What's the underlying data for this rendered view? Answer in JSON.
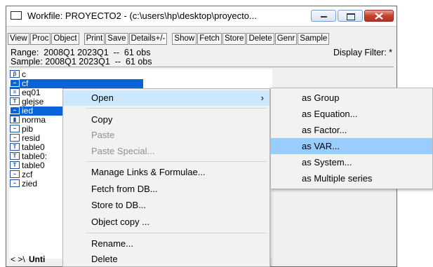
{
  "window": {
    "title": "Workfile: PROYECTO2 - (c:\\users\\hp\\desktop\\proyecto..."
  },
  "toolbar": [
    "View",
    "Proc",
    "Object",
    "Print",
    "Save",
    "Details+/-",
    "Show",
    "Fetch",
    "Store",
    "Delete",
    "Genr",
    "Sample"
  ],
  "info": {
    "range": "Range:  2008Q1 2023Q1  --  61 obs",
    "sample": "Sample: 2008Q1 2023Q1  --  61 obs",
    "filter": "Display Filter: *"
  },
  "objects": [
    {
      "name": "c",
      "icon": "beta-icon",
      "glyph": "β"
    },
    {
      "name": "cf",
      "icon": "series-icon",
      "glyph": "~"
    },
    {
      "name": "eq01",
      "icon": "equation-icon",
      "glyph": "="
    },
    {
      "name": "glejse",
      "icon": "table-icon",
      "glyph": "T"
    },
    {
      "name": "ied",
      "icon": "series-icon",
      "glyph": "~"
    },
    {
      "name": "norma",
      "icon": "graph-icon",
      "glyph": "▮"
    },
    {
      "name": "pib",
      "icon": "series-icon",
      "glyph": "~"
    },
    {
      "name": "resid",
      "icon": "series-icon",
      "glyph": "~"
    },
    {
      "name": "table0",
      "icon": "table-icon",
      "glyph": "T"
    },
    {
      "name": "table0:",
      "icon": "table-icon",
      "glyph": "T"
    },
    {
      "name": "table0",
      "icon": "table-icon",
      "glyph": "T"
    },
    {
      "name": "zcf",
      "icon": "series-icon",
      "glyph": "~"
    },
    {
      "name": "zied",
      "icon": "series-icon",
      "glyph": "~"
    }
  ],
  "tabs": {
    "nav": "< >\\",
    "current": "Unti"
  },
  "menu": {
    "open": "Open",
    "copy": "Copy",
    "paste": "Paste",
    "paste_special": "Paste Special...",
    "manage_links": "Manage Links & Formulae...",
    "fetch_db": "Fetch from DB...",
    "store_db": "Store to DB...",
    "object_copy": "Object copy ...",
    "rename": "Rename...",
    "delete": "Delete"
  },
  "submenu": [
    "as Group",
    "as Equation...",
    "as Factor...",
    "as VAR...",
    "as System...",
    "as Multiple series"
  ],
  "colors": {
    "selection": "#0a64d8",
    "menu_highlight": "#cce8ff",
    "submenu_highlight": "#99ccff"
  }
}
